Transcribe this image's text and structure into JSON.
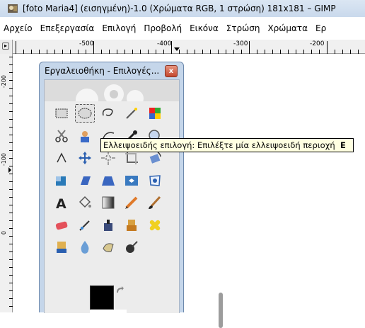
{
  "window": {
    "title": "[foto Maria4] (εισηγμένη)-1.0 (Χρώματα RGB, 1 στρώση) 181x181 – GIMP"
  },
  "menubar": {
    "items": [
      "Αρχείο",
      "Επεξεργασία",
      "Επιλογή",
      "Προβολή",
      "Εικόνα",
      "Στρώση",
      "Χρώματα",
      "Ερ"
    ]
  },
  "rulers": {
    "horizontal_labels": [
      "-500",
      "-400",
      "-300",
      "-200"
    ],
    "vertical_labels": [
      "-200",
      "-100",
      "0"
    ]
  },
  "toolbox": {
    "title": "Εργαλειοθήκη - Επιλογές...",
    "close_label": "x",
    "tools": [
      {
        "name": "rect-select-icon",
        "active": false
      },
      {
        "name": "ellipse-select-icon",
        "active": true
      },
      {
        "name": "free-select-icon",
        "active": false
      },
      {
        "name": "fuzzy-select-icon",
        "active": false
      },
      {
        "name": "color-select-icon",
        "active": false
      },
      {
        "name": "scissors-icon",
        "active": false
      },
      {
        "name": "foreground-select-icon",
        "active": false
      },
      {
        "name": "paths-icon",
        "active": false
      },
      {
        "name": "color-picker-icon",
        "active": false
      },
      {
        "name": "zoom-icon",
        "active": false
      },
      {
        "name": "measure-icon",
        "active": false
      },
      {
        "name": "move-icon",
        "active": false
      },
      {
        "name": "align-icon",
        "active": false
      },
      {
        "name": "crop-icon",
        "active": false
      },
      {
        "name": "rotate-icon",
        "active": false
      },
      {
        "name": "scale-icon",
        "active": false
      },
      {
        "name": "shear-icon",
        "active": false
      },
      {
        "name": "perspective-icon",
        "active": false
      },
      {
        "name": "flip-icon",
        "active": false
      },
      {
        "name": "cage-icon",
        "active": false
      },
      {
        "name": "text-icon",
        "active": false
      },
      {
        "name": "bucket-fill-icon",
        "active": false
      },
      {
        "name": "blend-icon",
        "active": false
      },
      {
        "name": "pencil-icon",
        "active": false
      },
      {
        "name": "paintbrush-icon",
        "active": false
      },
      {
        "name": "eraser-icon",
        "active": false
      },
      {
        "name": "airbrush-icon",
        "active": false
      },
      {
        "name": "ink-icon",
        "active": false
      },
      {
        "name": "clone-icon",
        "active": false
      },
      {
        "name": "heal-icon",
        "active": false
      },
      {
        "name": "perspective-clone-icon",
        "active": false
      },
      {
        "name": "blur-icon",
        "active": false
      },
      {
        "name": "smudge-icon",
        "active": false
      },
      {
        "name": "dodge-burn-icon",
        "active": false
      }
    ],
    "foreground_color": "#000000",
    "background_color": "#ffffff"
  },
  "tooltip": {
    "text": "Ελλειψοειδής επιλογή: Επιλέξτε μία ελλειψοειδή περιοχή",
    "shortcut": "E"
  }
}
